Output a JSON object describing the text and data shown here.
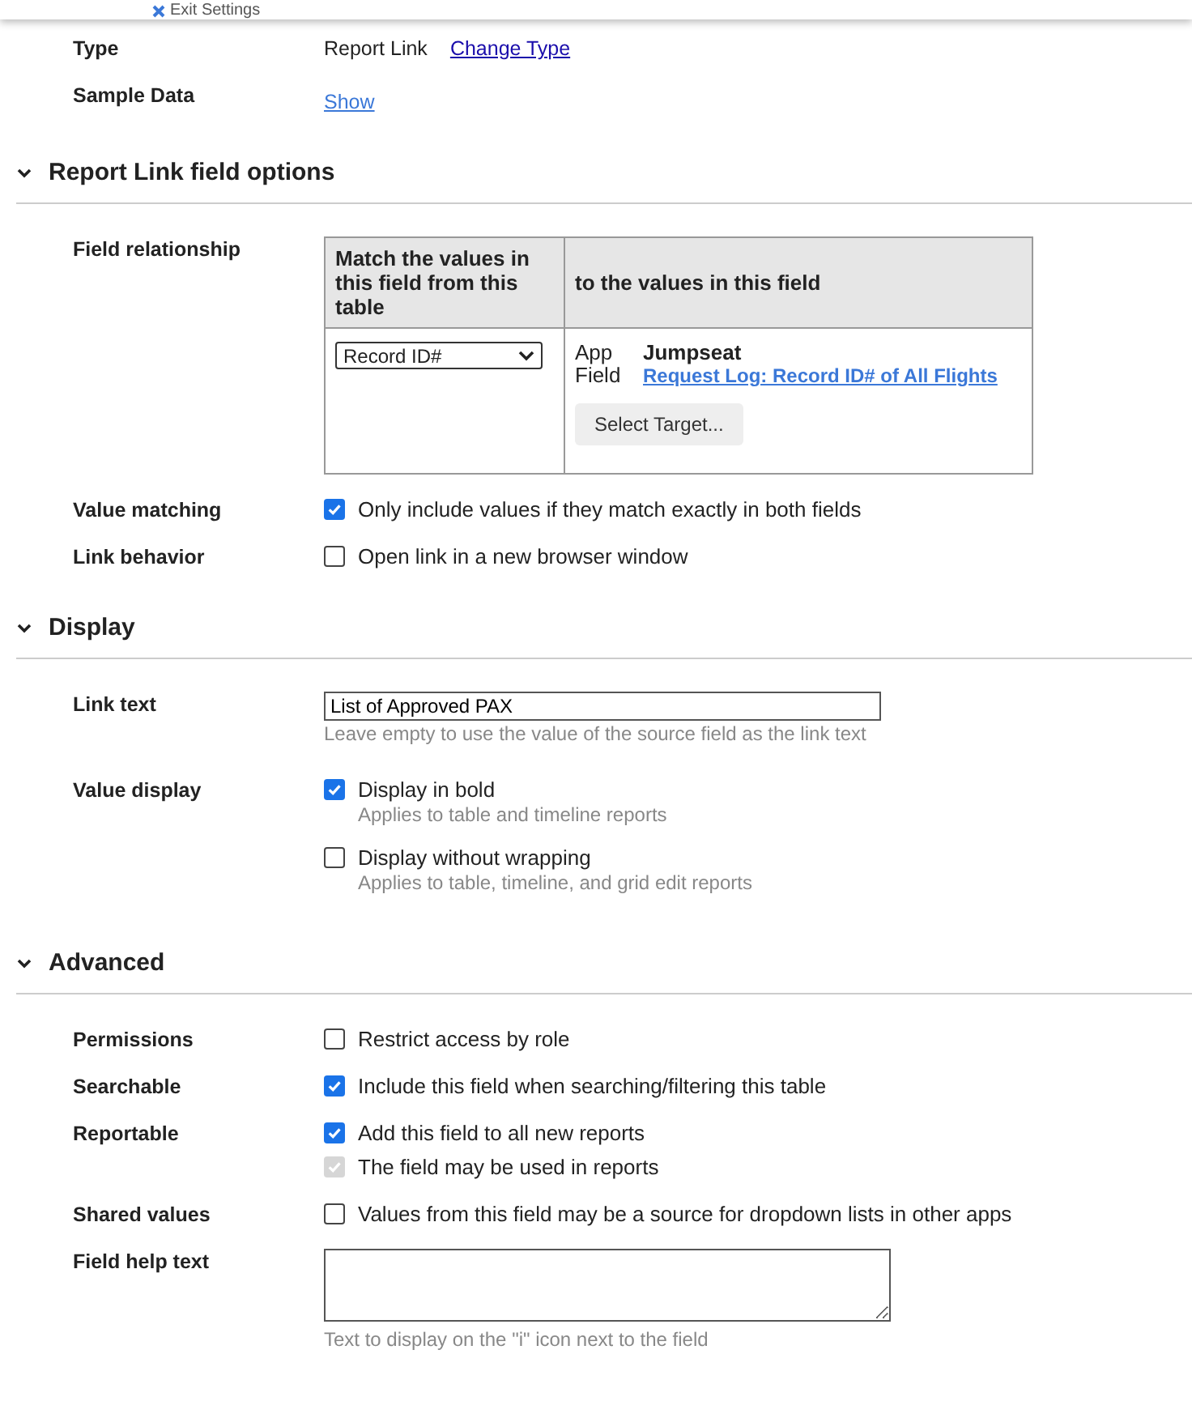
{
  "top_bar": {
    "exit_label": "Exit Settings"
  },
  "general": [
    {
      "kind": "type",
      "label": "Type",
      "value": "Report Link",
      "link": "Change Type"
    },
    {
      "kind": "link",
      "label": "Sample Data",
      "link": "Show"
    }
  ],
  "sections": [
    {
      "title": "Report Link field options",
      "expanded": true,
      "rows": [
        {
          "kind": "relationship",
          "label": "Field relationship",
          "left_header": "Match the values in this field from this table",
          "right_header": "to the values in this field",
          "source_select": "Record ID#",
          "app_label": "App",
          "app_value": "Jumpseat",
          "field_label": "Field",
          "field_value": "Request Log: Record ID# of All Flights",
          "button": "Select Target..."
        },
        {
          "kind": "checkboxes",
          "label": "Value matching",
          "options": [
            {
              "label": "Only include values if they match exactly in both fields",
              "checked": true,
              "disabled": false
            }
          ]
        },
        {
          "kind": "checkboxes",
          "label": "Link behavior",
          "options": [
            {
              "label": "Open link in a new browser window",
              "checked": false,
              "disabled": false
            }
          ]
        }
      ]
    },
    {
      "title": "Display",
      "expanded": true,
      "rows": [
        {
          "kind": "text-input",
          "label": "Link text",
          "value": "List of Approved PAX",
          "hint": "Leave empty to use the value of the source field as the link text"
        },
        {
          "kind": "checkboxes",
          "label": "Value display",
          "options": [
            {
              "label": "Display in bold",
              "checked": true,
              "disabled": false,
              "hint": "Applies to table and timeline reports"
            },
            {
              "label": "Display without wrapping",
              "checked": false,
              "disabled": false,
              "hint": "Applies to table, timeline, and grid edit reports"
            }
          ]
        }
      ]
    },
    {
      "title": "Advanced",
      "expanded": true,
      "rows": [
        {
          "kind": "checkboxes",
          "label": "Permissions",
          "options": [
            {
              "label": "Restrict access by role",
              "checked": false,
              "disabled": false
            }
          ]
        },
        {
          "kind": "checkboxes",
          "label": "Searchable",
          "options": [
            {
              "label": "Include this field when searching/filtering this table",
              "checked": true,
              "disabled": false
            }
          ]
        },
        {
          "kind": "checkboxes",
          "label": "Reportable",
          "options": [
            {
              "label": "Add this field to all new reports",
              "checked": true,
              "disabled": false
            },
            {
              "label": "The field may be used in reports",
              "checked": true,
              "disabled": true
            }
          ]
        },
        {
          "kind": "checkboxes",
          "label": "Shared values",
          "options": [
            {
              "label": "Values from this field may be a source for dropdown lists in other apps",
              "checked": false,
              "disabled": false
            }
          ]
        },
        {
          "kind": "textarea",
          "label": "Field help text",
          "hint": "Text to display on the \"i\" icon next to the field"
        }
      ]
    }
  ]
}
